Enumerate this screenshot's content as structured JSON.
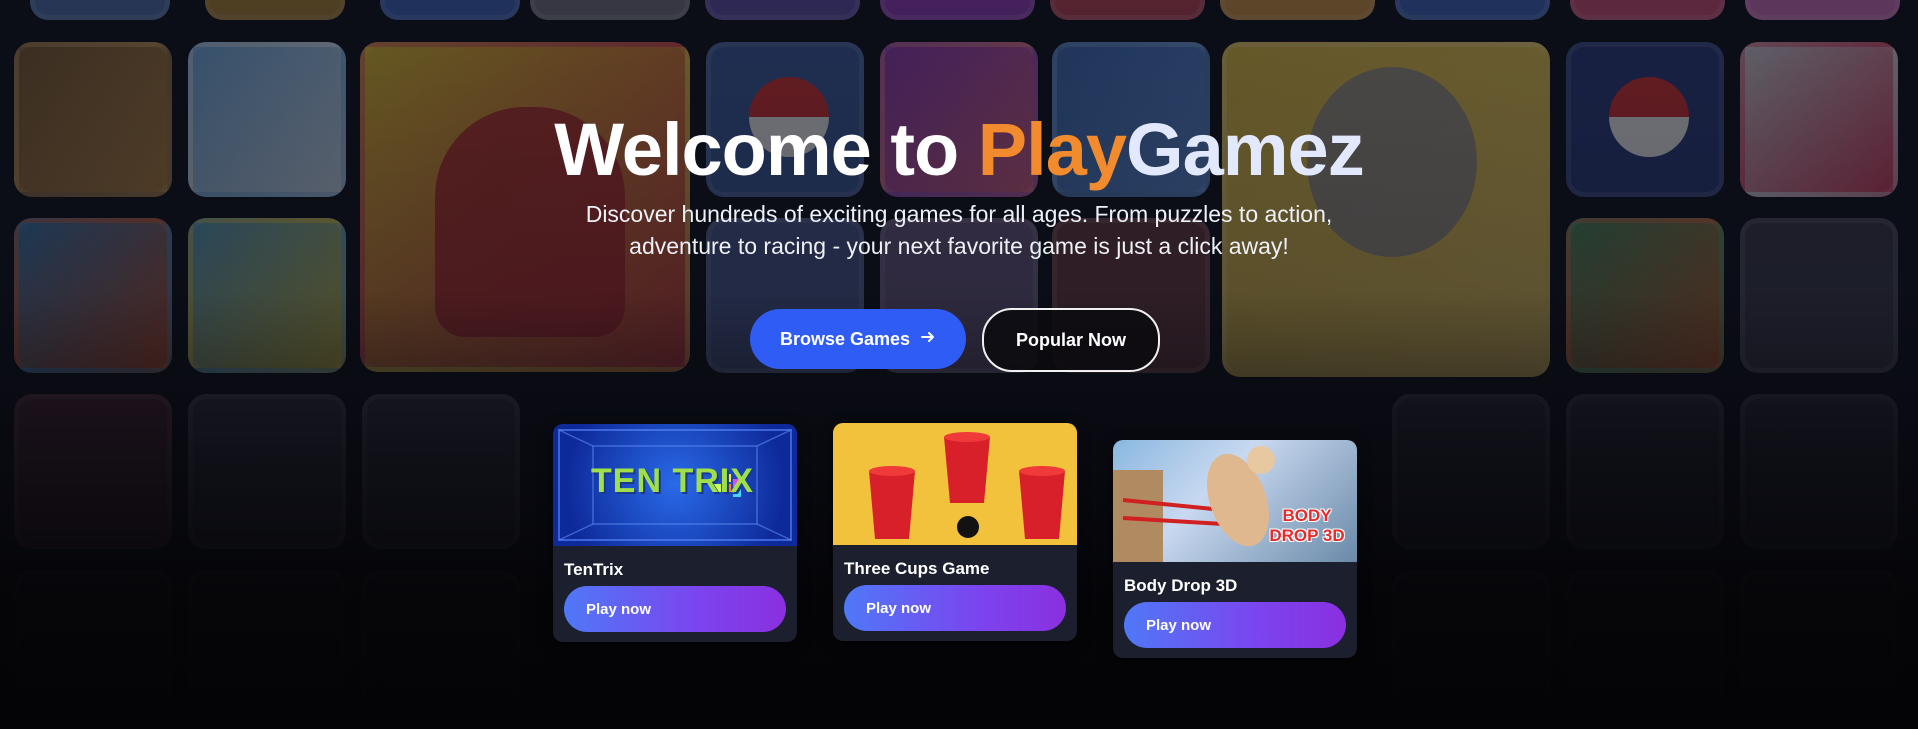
{
  "hero": {
    "title_part1": "Welcome to ",
    "title_accent": "Play",
    "title_part2": "Gamez",
    "subtitle": "Discover hundreds of exciting games for all ages. From puzzles to action, adventure to racing - your next favorite game is just a click away!"
  },
  "actions": {
    "browse_label": "Browse Games",
    "browse_icon": "arrow-right-icon",
    "popular_label": "Popular Now"
  },
  "featured_games": [
    {
      "name": "TenTrix",
      "thumb_text": "TEN TRIX",
      "play_label": "Play now"
    },
    {
      "name": "Three Cups Game",
      "thumb_text": "",
      "play_label": "Play now"
    },
    {
      "name": "Body Drop 3D",
      "thumb_text": "BODY DROP 3D",
      "play_label": "Play now"
    }
  ],
  "colors": {
    "accent": "#f28a2e",
    "primary_button": "#2f5cf5",
    "play_gradient_start": "#4f78f7",
    "play_gradient_end": "#8a2fe0",
    "card_background": "#1b1f2e"
  }
}
